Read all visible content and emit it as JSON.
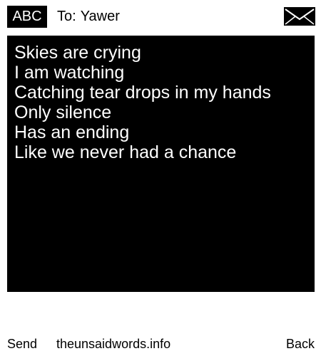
{
  "header": {
    "input_mode": "ABC",
    "to_prefix": "To:",
    "recipient": "Yawer",
    "envelope_icon": "envelope-icon"
  },
  "message": {
    "lines": [
      "Skies are crying",
      "I am watching",
      "Catching tear drops in my hands",
      "Only silence",
      "Has an ending",
      "Like we never had a chance"
    ]
  },
  "softkeys": {
    "left": "Send",
    "center": "theunsaidwords.info",
    "right": "Back"
  },
  "colors": {
    "background": "#ffffff",
    "message_background": "#000000",
    "message_text": "#ffffff",
    "text": "#000000"
  }
}
